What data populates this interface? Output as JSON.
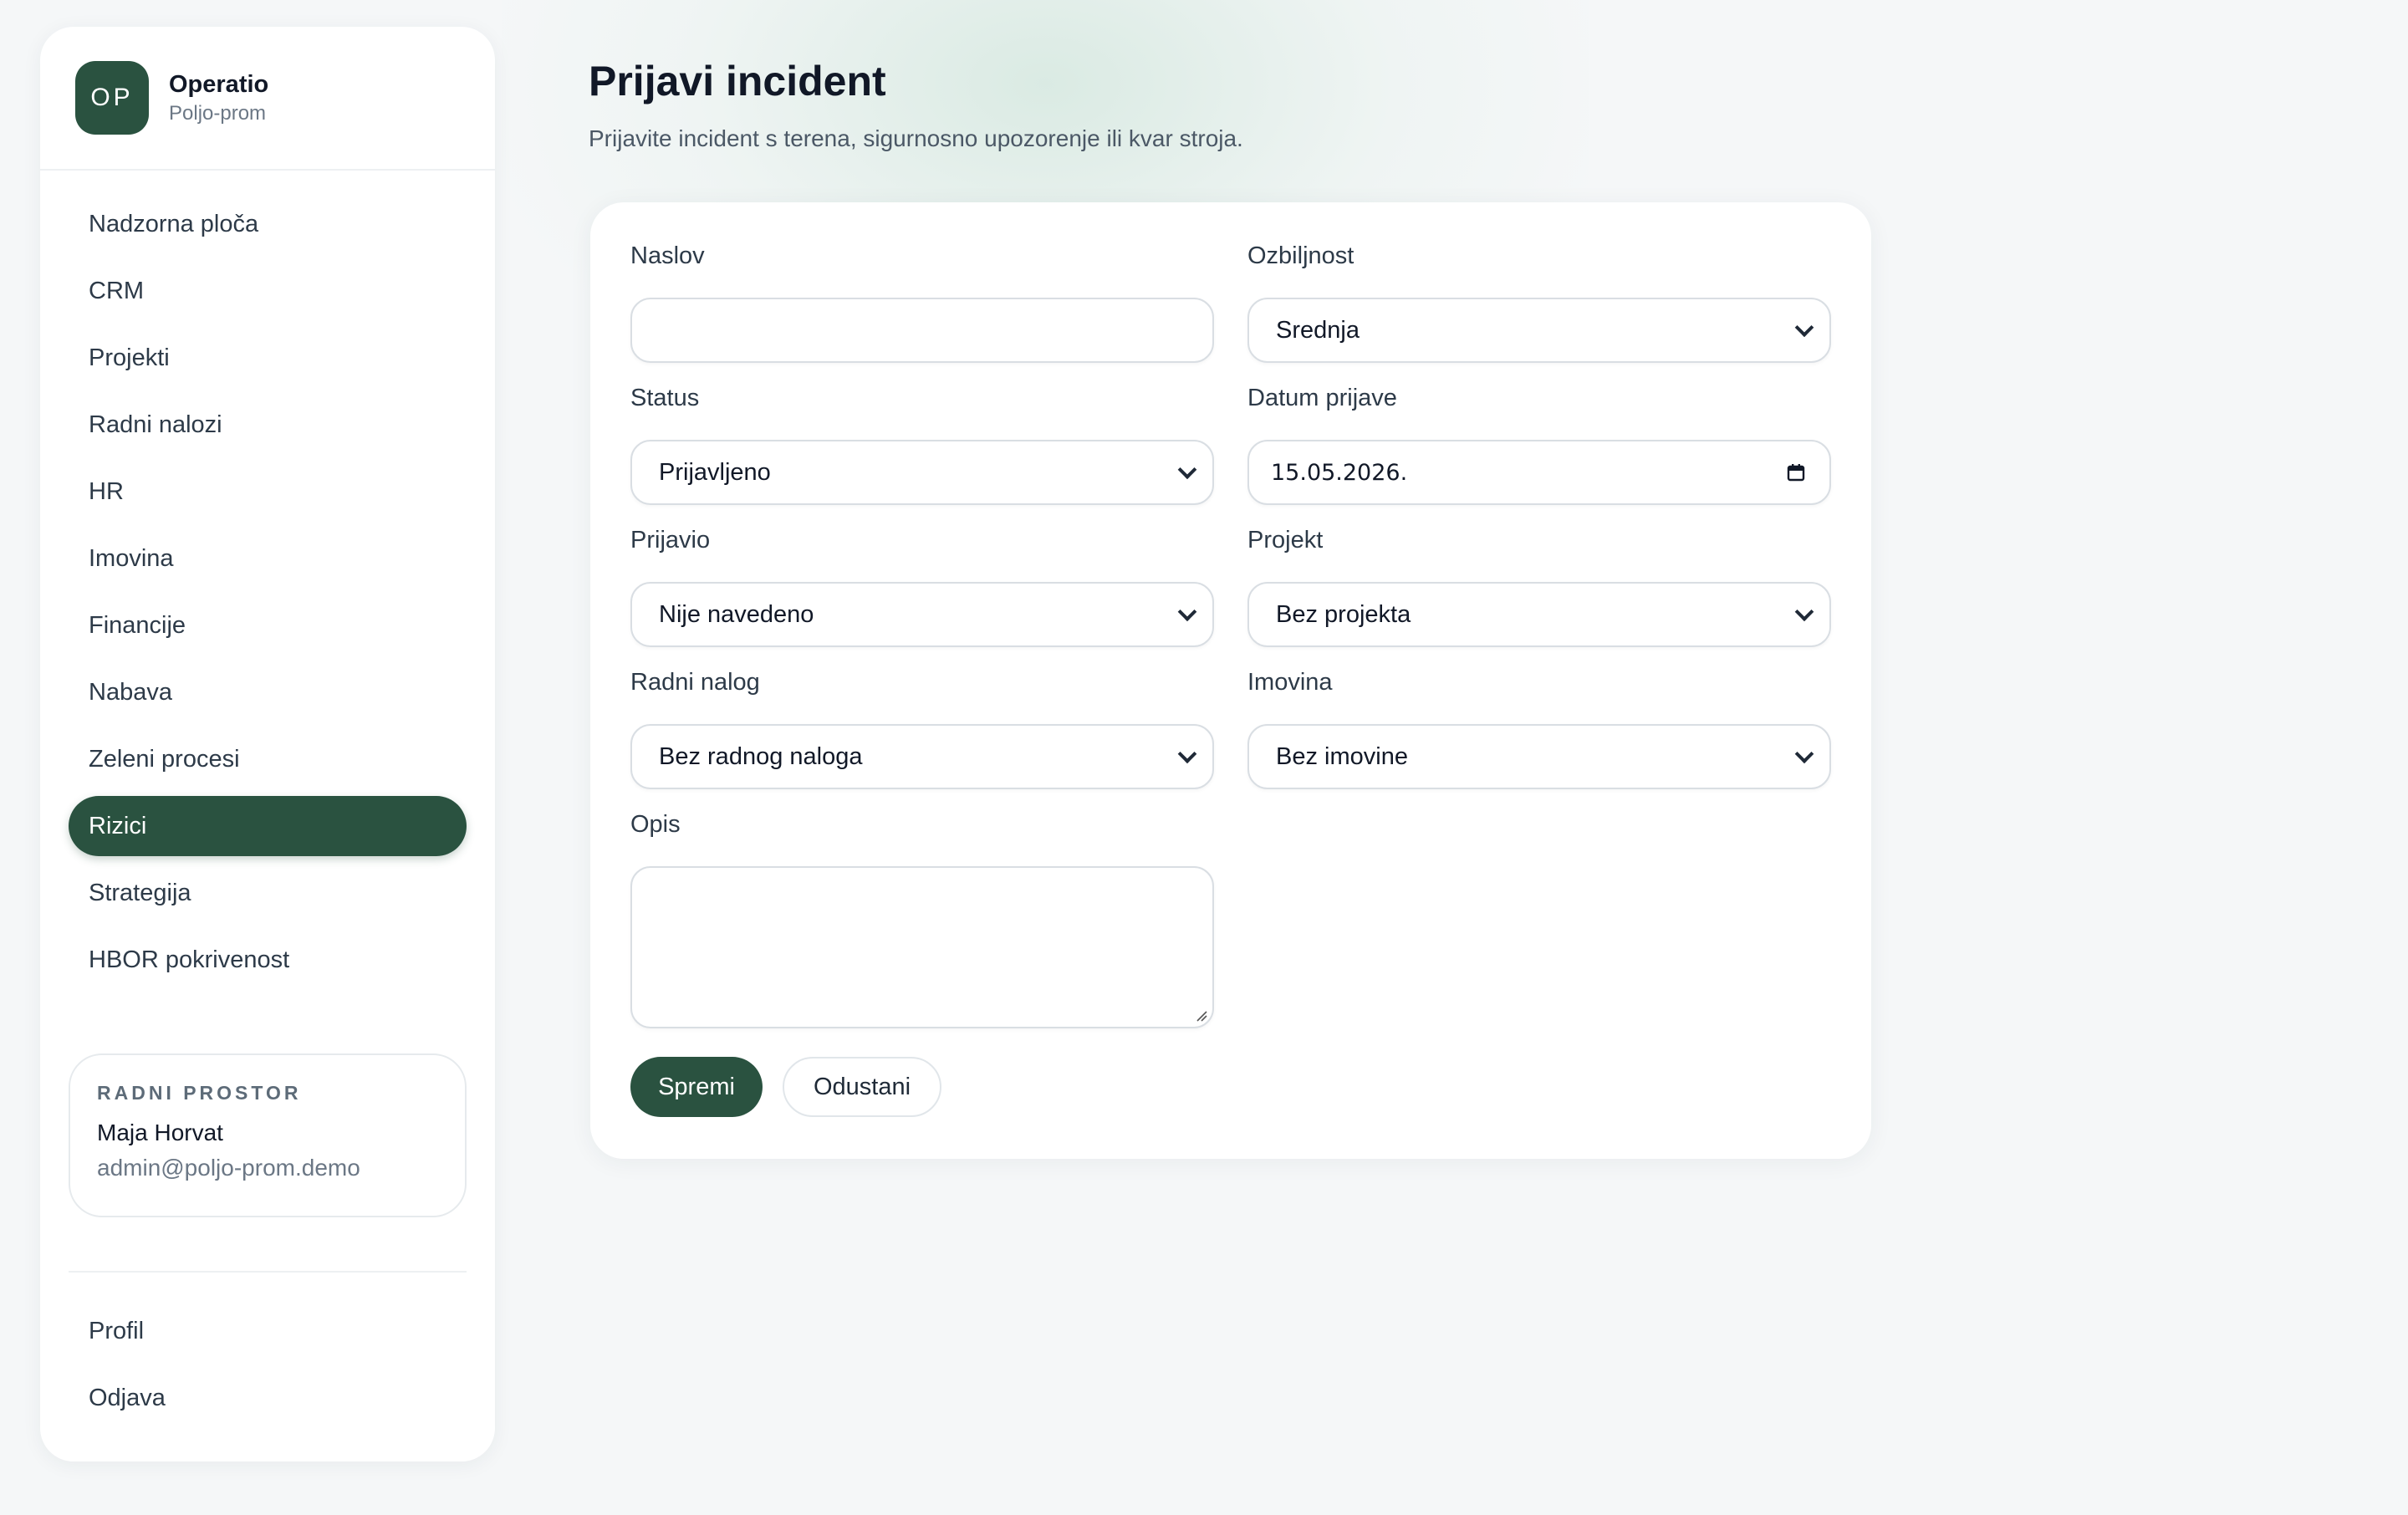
{
  "brand": {
    "logo": "OP",
    "name": "Operatio",
    "subtitle": "Poljo-prom"
  },
  "nav": {
    "items": [
      {
        "label": "Nadzorna ploča"
      },
      {
        "label": "CRM"
      },
      {
        "label": "Projekti"
      },
      {
        "label": "Radni nalozi"
      },
      {
        "label": "HR"
      },
      {
        "label": "Imovina"
      },
      {
        "label": "Financije"
      },
      {
        "label": "Nabava"
      },
      {
        "label": "Zeleni procesi"
      },
      {
        "label": "Rizici",
        "active": true
      },
      {
        "label": "Strategija"
      },
      {
        "label": "HBOR pokrivenost"
      }
    ],
    "bottom": [
      {
        "label": "Profil"
      },
      {
        "label": "Odjava"
      }
    ]
  },
  "workspace": {
    "label": "RADNI PROSTOR",
    "user": "Maja Horvat",
    "email": "admin@poljo-prom.demo"
  },
  "page": {
    "title": "Prijavi incident",
    "subtitle": "Prijavite incident s terena, sigurnosno upozorenje ili kvar stroja."
  },
  "form": {
    "naslov": {
      "label": "Naslov",
      "value": ""
    },
    "ozbiljnost": {
      "label": "Ozbiljnost",
      "value": "Srednja"
    },
    "status": {
      "label": "Status",
      "value": "Prijavljeno"
    },
    "datum": {
      "label": "Datum prijave",
      "value": "15.05.2026."
    },
    "prijavio": {
      "label": "Prijavio",
      "value": "Nije navedeno"
    },
    "projekt": {
      "label": "Projekt",
      "value": "Bez projekta"
    },
    "radni_nalog": {
      "label": "Radni nalog",
      "value": "Bez radnog naloga"
    },
    "imovina": {
      "label": "Imovina",
      "value": "Bez imovine"
    },
    "opis": {
      "label": "Opis",
      "value": ""
    },
    "save_label": "Spremi",
    "cancel_label": "Odustani"
  },
  "colors": {
    "accent": "#2a5240",
    "background": "#f5f7f8",
    "card": "#ffffff"
  },
  "icons": {
    "select": "chevron-down-icon",
    "date": "calendar-icon",
    "textarea": "resize-handle-icon"
  }
}
